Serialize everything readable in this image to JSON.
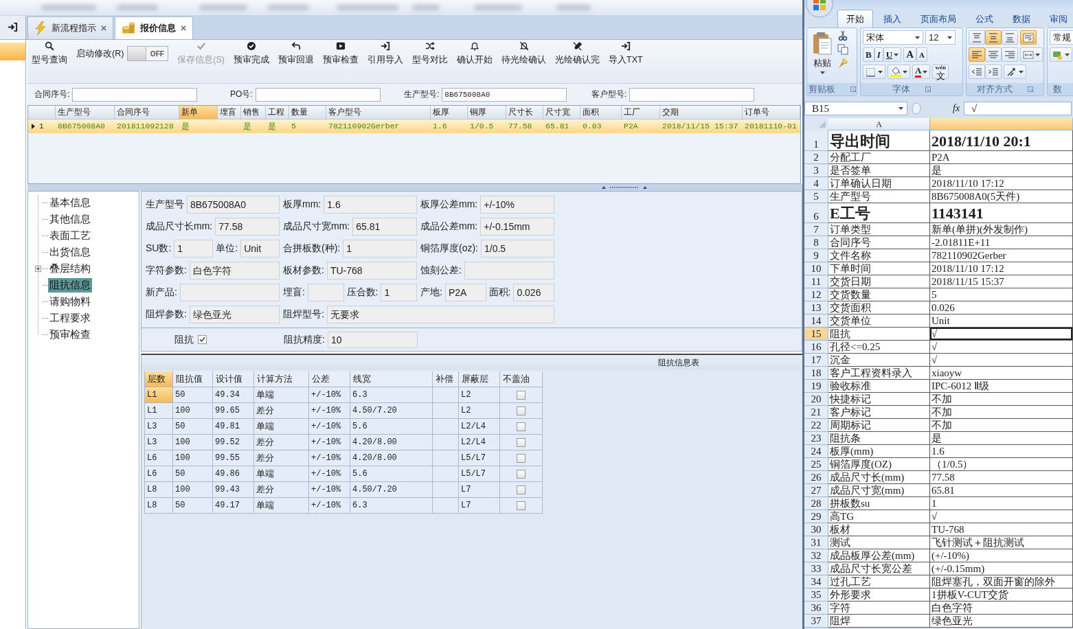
{
  "tabs": [
    {
      "label": "新流程指示",
      "selected": false
    },
    {
      "label": "报价信息",
      "selected": true
    }
  ],
  "toolbar": [
    {
      "kind": "button",
      "label": "型号查询",
      "disabled": false
    },
    {
      "kind": "toggle",
      "label": "启动修改(R)",
      "state_text": "OFF",
      "on": false
    },
    {
      "kind": "button",
      "label": "保存信息(S)",
      "disabled": true
    },
    {
      "kind": "button",
      "label": "预审完成",
      "disabled": false
    },
    {
      "kind": "button",
      "label": "预审回退",
      "disabled": false
    },
    {
      "kind": "button",
      "label": "预审检查",
      "disabled": false
    },
    {
      "kind": "button",
      "label": "引用导入",
      "disabled": false
    },
    {
      "kind": "button",
      "label": "型号对比",
      "disabled": false
    },
    {
      "kind": "button",
      "label": "确认开始",
      "disabled": false
    },
    {
      "kind": "button",
      "label": "待光绘确认",
      "disabled": false
    },
    {
      "kind": "button",
      "label": "光绘确认完",
      "disabled": false
    },
    {
      "kind": "button",
      "label": "导入TXT",
      "disabled": false
    }
  ],
  "search_fields": [
    {
      "label": "合同序号:"
    },
    {
      "label": "PO号:"
    },
    {
      "label": "生产型号:",
      "value": "8B675008A0"
    },
    {
      "label": "客户型号:"
    }
  ],
  "order_table": {
    "columns": [
      {
        "label": "生产型号",
        "selected": false
      },
      {
        "label": "合同序号",
        "selected": false
      },
      {
        "label": "新单",
        "selected": true
      },
      {
        "label": "埋盲",
        "selected": false
      },
      {
        "label": "销售",
        "selected": false
      },
      {
        "label": "工程",
        "selected": false
      },
      {
        "label": "数量",
        "selected": false
      },
      {
        "label": "客户型号",
        "selected": false
      },
      {
        "label": "板厚",
        "selected": false
      },
      {
        "label": "铜厚",
        "selected": false
      },
      {
        "label": "尺寸长",
        "selected": false
      },
      {
        "label": "尺寸宽",
        "selected": false
      },
      {
        "label": "面积",
        "selected": false
      },
      {
        "label": "工厂",
        "selected": false
      },
      {
        "label": "交期",
        "selected": false
      },
      {
        "label": "订单号",
        "selected": false
      }
    ],
    "rows": [
      {
        "number": "1",
        "current": true,
        "cells": [
          "8B675008A0",
          "201811092128",
          "是",
          null,
          "是",
          "是",
          "5",
          "782110902Gerber",
          "1.6",
          "1/0.5",
          "77.58",
          "65.81",
          "0.03",
          "P2A",
          "2018/11/15 15:37",
          "20181110-01"
        ]
      }
    ]
  },
  "nav_tree": [
    {
      "label": "基本信息",
      "selected": false
    },
    {
      "label": "其他信息",
      "selected": false
    },
    {
      "label": "表面工艺",
      "selected": false
    },
    {
      "label": "出货信息",
      "selected": false
    },
    {
      "label": "叠层结构",
      "selected": false,
      "expanded": false
    },
    {
      "label": "阻抗信息",
      "selected": true
    },
    {
      "label": "请购物料",
      "selected": false
    },
    {
      "label": "工程要求",
      "selected": false
    },
    {
      "label": "预审检查",
      "selected": false
    }
  ],
  "form_rows": [
    [
      [
        {
          "label": "生产型号",
          "value": "8B675008A0"
        }
      ],
      [
        {
          "label": "板厚mm:",
          "value": "1.6"
        }
      ],
      [
        {
          "label": "板厚公差mm:",
          "value": "+/-10%"
        }
      ]
    ],
    [
      [
        {
          "label": "成品尺寸长mm:",
          "value": "77.58"
        }
      ],
      [
        {
          "label": "成品尺寸宽mm:",
          "value": "65.81"
        }
      ],
      [
        {
          "label": "成品公差mm:",
          "value": "+/-0.15mm"
        }
      ]
    ],
    [
      [
        {
          "label": "SU数:",
          "value": "1"
        },
        {
          "label": "单位:",
          "value": "Unit"
        }
      ],
      [
        {
          "label": "合拼板数(种):",
          "value": "1"
        }
      ],
      [
        {
          "label": "铜箔厚度(oz):",
          "value": "1/0.5"
        }
      ]
    ],
    [
      [
        {
          "label": "字符参数:",
          "value": "白色字符"
        }
      ],
      [
        {
          "label": "板材参数:",
          "value": "TU-768"
        }
      ],
      [
        {
          "label": "蚀刻公差:"
        }
      ]
    ],
    [
      [
        {
          "label": "新产品:"
        }
      ],
      [
        {
          "label": "埋盲:"
        },
        {
          "label": "压合数:",
          "value": "1"
        }
      ],
      [
        {
          "label": "产地:",
          "value": "P2A"
        },
        {
          "label": "面积:",
          "value": "0.026"
        }
      ]
    ],
    [
      [
        {
          "label": "阻焊参数:",
          "value": "绿色亚光"
        }
      ],
      [
        {
          "label": "阻焊型号:",
          "value": "无要求"
        }
      ]
    ]
  ],
  "impedance": {
    "checkbox": {
      "label": "阻抗",
      "checked": true
    },
    "precision": {
      "label": "阻抗精度:",
      "value": "10"
    },
    "table": {
      "title": "阻抗信息表",
      "columns": [
        {
          "label": "层数",
          "selected": true
        },
        {
          "label": "阻抗值",
          "selected": false
        },
        {
          "label": "设计值",
          "selected": false
        },
        {
          "label": "计算方法",
          "selected": false
        },
        {
          "label": "公差",
          "selected": false
        },
        {
          "label": "线宽",
          "selected": false
        },
        {
          "label": "补偿",
          "selected": false
        },
        {
          "label": "屏蔽层",
          "selected": false
        },
        {
          "label": "不盖油",
          "selected": false
        }
      ],
      "rows": [
        {
          "selected": true,
          "cells": [
            "L1",
            "50",
            "49.34",
            "单端",
            "+/-10%",
            "6.3",
            null,
            "L2"
          ],
          "no_solder_mask": false
        },
        {
          "selected": false,
          "cells": [
            "L1",
            "100",
            "99.65",
            "差分",
            "+/-10%",
            "4.50/7.20",
            null,
            "L2"
          ],
          "no_solder_mask": false
        },
        {
          "selected": false,
          "cells": [
            "L3",
            "50",
            "49.81",
            "单端",
            "+/-10%",
            "5.6",
            null,
            "L2/L4"
          ],
          "no_solder_mask": false
        },
        {
          "selected": false,
          "cells": [
            "L3",
            "100",
            "99.52",
            "差分",
            "+/-10%",
            "4.20/8.00",
            null,
            "L2/L4"
          ],
          "no_solder_mask": false
        },
        {
          "selected": false,
          "cells": [
            "L6",
            "100",
            "99.55",
            "差分",
            "+/-10%",
            "4.20/8.00",
            null,
            "L5/L7"
          ],
          "no_solder_mask": false
        },
        {
          "selected": false,
          "cells": [
            "L6",
            "50",
            "49.86",
            "单端",
            "+/-10%",
            "5.6",
            null,
            "L5/L7"
          ],
          "no_solder_mask": false
        },
        {
          "selected": false,
          "cells": [
            "L8",
            "100",
            "99.43",
            "差分",
            "+/-10%",
            "4.50/7.20",
            null,
            "L7"
          ],
          "no_solder_mask": false
        },
        {
          "selected": false,
          "cells": [
            "L8",
            "50",
            "49.17",
            "单端",
            "+/-10%",
            "6.3",
            null,
            "L7"
          ],
          "no_solder_mask": false
        }
      ]
    }
  },
  "excel": {
    "tabs": [
      {
        "label": "开始",
        "selected": true
      },
      {
        "label": "插入",
        "selected": false
      },
      {
        "label": "页面布局",
        "selected": false
      },
      {
        "label": "公式",
        "selected": false
      },
      {
        "label": "数据",
        "selected": false
      },
      {
        "label": "审阅",
        "selected": false
      }
    ],
    "clipboard": {
      "label": "剪贴板",
      "paste": "粘贴"
    },
    "font": {
      "label": "字体",
      "name": "宋体",
      "size": "12",
      "style_buttons": [
        "B",
        "I",
        "U"
      ],
      "size_buttons": [
        "A",
        "A"
      ],
      "color_button": "A",
      "phonetic": [
        "wén",
        "文"
      ]
    },
    "alignment": {
      "label": "对齐方式",
      "vertical": [
        {
          "selected": false
        },
        {
          "selected": true
        },
        {
          "selected": false
        }
      ],
      "horizontal": [
        {
          "selected": true
        },
        {
          "selected": false
        },
        {
          "selected": false
        }
      ],
      "wrap_text": true
    },
    "number": {
      "label": "数",
      "format": "常规"
    },
    "name_box": "B15",
    "function_sign": "fx",
    "formula": "√",
    "columns": [
      {
        "label": "A",
        "selected": false
      },
      {
        "selected": true
      }
    ],
    "rows": [
      {
        "number": "1",
        "kind": "heading",
        "label": "导出时间",
        "value": "2018/11/10 20:1",
        "selected": false
      },
      {
        "number": "2",
        "kind": "normal",
        "label": "分配工厂",
        "value": "P2A",
        "selected": false
      },
      {
        "number": "3",
        "kind": "normal",
        "label": "是否签单",
        "value": "是",
        "selected": false
      },
      {
        "number": "4",
        "kind": "normal",
        "label": "订单确认日期",
        "value": "2018/11/10 17:12",
        "selected": false
      },
      {
        "number": "5",
        "kind": "normal",
        "label": "生产型号",
        "value": "8B675008A0(5天件)",
        "selected": false
      },
      {
        "number": "6",
        "kind": "heading",
        "label": "E工号",
        "value": "1143141",
        "selected": false
      },
      {
        "number": "7",
        "kind": "normal",
        "label": "订单类型",
        "value": "新单(单拼)(外发制作)",
        "selected": false
      },
      {
        "number": "8",
        "kind": "normal",
        "label": "合同序号",
        "value": "-2.01811E+11",
        "selected": false
      },
      {
        "number": "9",
        "kind": "normal",
        "label": "文件名称",
        "value": "782110902Gerber",
        "selected": false
      },
      {
        "number": "10",
        "kind": "normal",
        "label": "下单时间",
        "value": "2018/11/10 17:12",
        "selected": false
      },
      {
        "number": "11",
        "kind": "normal",
        "label": "交货日期",
        "value": "2018/11/15 15:37",
        "selected": false
      },
      {
        "number": "12",
        "kind": "normal",
        "label": "交货数量",
        "value": "5",
        "selected": false
      },
      {
        "number": "13",
        "kind": "normal",
        "label": "交货面积",
        "value": "0.026",
        "selected": false
      },
      {
        "number": "14",
        "kind": "normal",
        "label": "交货单位",
        "value": "Unit",
        "selected": false
      },
      {
        "number": "15",
        "kind": "normal",
        "label": "阻抗",
        "value": "√",
        "selected": true
      },
      {
        "number": "16",
        "kind": "normal",
        "label": "孔径<=0.25",
        "value": "√",
        "selected": false
      },
      {
        "number": "17",
        "kind": "normal",
        "label": "沉金",
        "value": "√",
        "selected": false
      },
      {
        "number": "18",
        "kind": "normal",
        "label": "客户工程资料录入",
        "value": "xiaoyw",
        "selected": false
      },
      {
        "number": "19",
        "kind": "normal",
        "label": "验收标准",
        "value": "IPC-6012 Ⅱ级",
        "selected": false
      },
      {
        "number": "20",
        "kind": "normal",
        "label": "快捷标记",
        "value": "不加",
        "selected": false
      },
      {
        "number": "21",
        "kind": "normal",
        "label": "客户标记",
        "value": "不加",
        "selected": false
      },
      {
        "number": "22",
        "kind": "normal",
        "label": "周期标记",
        "value": "不加",
        "selected": false
      },
      {
        "number": "23",
        "kind": "normal",
        "label": "阻抗条",
        "value": "是",
        "selected": false
      },
      {
        "number": "24",
        "kind": "normal",
        "label": "板厚(mm)",
        "value": "1.6",
        "selected": false
      },
      {
        "number": "25",
        "kind": "normal",
        "label": "铜箔厚度(OZ)",
        "value": "（1/0.5）",
        "selected": false
      },
      {
        "number": "26",
        "kind": "normal",
        "label": "成品尺寸长(mm)",
        "value": "77.58",
        "selected": false
      },
      {
        "number": "27",
        "kind": "normal",
        "label": "成品尺寸宽(mm)",
        "value": "65.81",
        "selected": false
      },
      {
        "number": "28",
        "kind": "normal",
        "label": "拼板数su",
        "value": "1",
        "selected": false
      },
      {
        "number": "29",
        "kind": "normal",
        "label": "高TG",
        "value": "√",
        "selected": false
      },
      {
        "number": "30",
        "kind": "normal",
        "label": "板材",
        "value": "TU-768",
        "selected": false
      },
      {
        "number": "31",
        "kind": "normal",
        "label": "测试",
        "value": "飞针测试＋阻抗测试",
        "selected": false
      },
      {
        "number": "32",
        "kind": "normal",
        "label": "成品板厚公差(mm)",
        "value": "(+/-10%)",
        "selected": false
      },
      {
        "number": "33",
        "kind": "normal",
        "label": "成品尺寸长宽公差",
        "value": "(+/-0.15mm)",
        "selected": false
      },
      {
        "number": "34",
        "kind": "normal",
        "label": "过孔工艺",
        "value": "阻焊塞孔，双面开窗的除外",
        "selected": false
      },
      {
        "number": "35",
        "kind": "normal",
        "label": "外形要求",
        "value": "1拼板V-CUT交货",
        "selected": false
      },
      {
        "number": "36",
        "kind": "normal",
        "label": "字符",
        "value": "白色字符",
        "selected": false
      },
      {
        "number": "37",
        "kind": "normal",
        "label": "阻焊",
        "value": "绿色亚光",
        "selected": false
      }
    ]
  }
}
